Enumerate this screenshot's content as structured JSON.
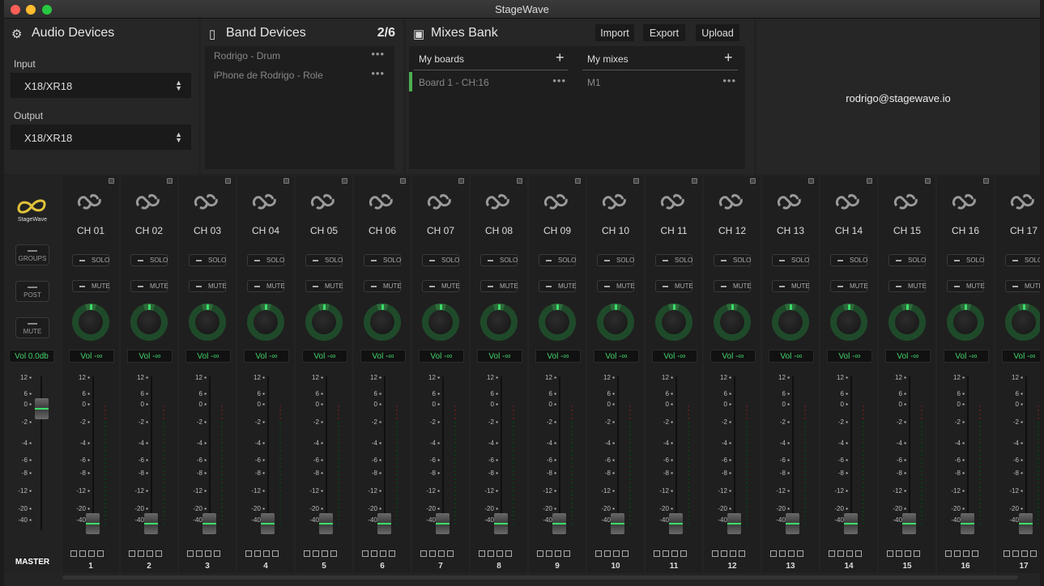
{
  "window": {
    "title": "StageWave"
  },
  "audio_devices": {
    "title": "Audio Devices",
    "icon": "gear-icon",
    "input_label": "Input",
    "input_value": "X18/XR18",
    "output_label": "Output",
    "output_value": "X18/XR18"
  },
  "band_devices": {
    "title": "Band Devices",
    "icon": "phone-icon",
    "count": "2/6",
    "items": [
      {
        "label": "Rodrigo - Drum"
      },
      {
        "label": "iPhone de Rodrigo - Role"
      }
    ]
  },
  "mixes_bank": {
    "title": "Mixes Bank",
    "icon": "library-icon",
    "import_label": "Import",
    "export_label": "Export",
    "upload_label": "Upload",
    "boards_header": "My boards",
    "mixes_header": "My mixes",
    "boards": [
      {
        "label": "Board 1 - CH:16"
      }
    ],
    "mixes": [
      {
        "label": "M1"
      }
    ]
  },
  "account": {
    "email": "rodrigo@stagewave.io"
  },
  "master": {
    "logo_text": "StageWave",
    "groups_label": "GROUPS",
    "post_label": "POST",
    "mute_label": "MUTE",
    "vol": "Vol 0.0db",
    "label": "MASTER"
  },
  "scale_ticks": [
    "12",
    "6",
    "0",
    "-2",
    "-4",
    "-6",
    "-8",
    "-12",
    "-20",
    "-40"
  ],
  "channel_buttons": {
    "solo": "SOLO",
    "mute": "MUTE",
    "vol": "Vol -∞"
  },
  "channels": [
    {
      "name": "CH 01",
      "num": "1"
    },
    {
      "name": "CH 02",
      "num": "2"
    },
    {
      "name": "CH 03",
      "num": "3"
    },
    {
      "name": "CH 04",
      "num": "4"
    },
    {
      "name": "CH 05",
      "num": "5"
    },
    {
      "name": "CH 06",
      "num": "6"
    },
    {
      "name": "CH 07",
      "num": "7"
    },
    {
      "name": "CH 08",
      "num": "8"
    },
    {
      "name": "CH 09",
      "num": "9"
    },
    {
      "name": "CH 10",
      "num": "10"
    },
    {
      "name": "CH 11",
      "num": "11"
    },
    {
      "name": "CH 12",
      "num": "12"
    },
    {
      "name": "CH 13",
      "num": "13"
    },
    {
      "name": "CH 14",
      "num": "14"
    },
    {
      "name": "CH 15",
      "num": "15"
    },
    {
      "name": "CH 16",
      "num": "16"
    },
    {
      "name": "CH 17",
      "num": "17"
    }
  ],
  "colors": {
    "accent": "#3ddc6a",
    "logo": "#e2c23a",
    "board_active": "#4caf50"
  }
}
